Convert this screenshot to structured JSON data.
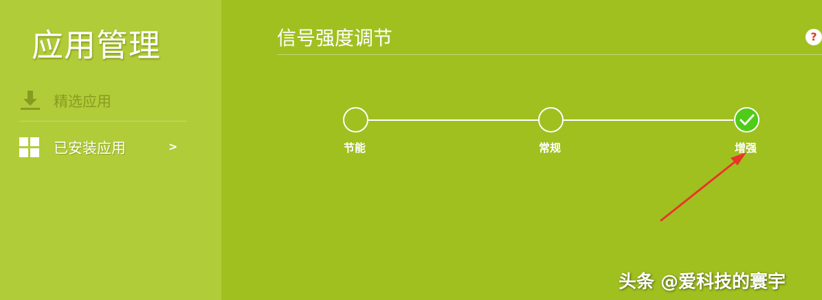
{
  "sidebar": {
    "title": "应用管理",
    "items": [
      {
        "label": "精选应用",
        "icon": "download-icon"
      },
      {
        "label": "已安装应用",
        "icon": "grid-icon",
        "chevron": ">"
      }
    ]
  },
  "main": {
    "title": "信号强度调节",
    "help_glyph": "?",
    "options": [
      {
        "label": "节能",
        "selected": false
      },
      {
        "label": "常规",
        "selected": false
      },
      {
        "label": "增强",
        "selected": true
      }
    ]
  },
  "colors": {
    "sidebar_bg": "#b0cc38",
    "main_bg": "#a0c020",
    "selected": "#4fcb18",
    "arrow": "#e8352a",
    "help": "#e03a1e"
  },
  "watermark": "头条 @爱科技的寰宇"
}
